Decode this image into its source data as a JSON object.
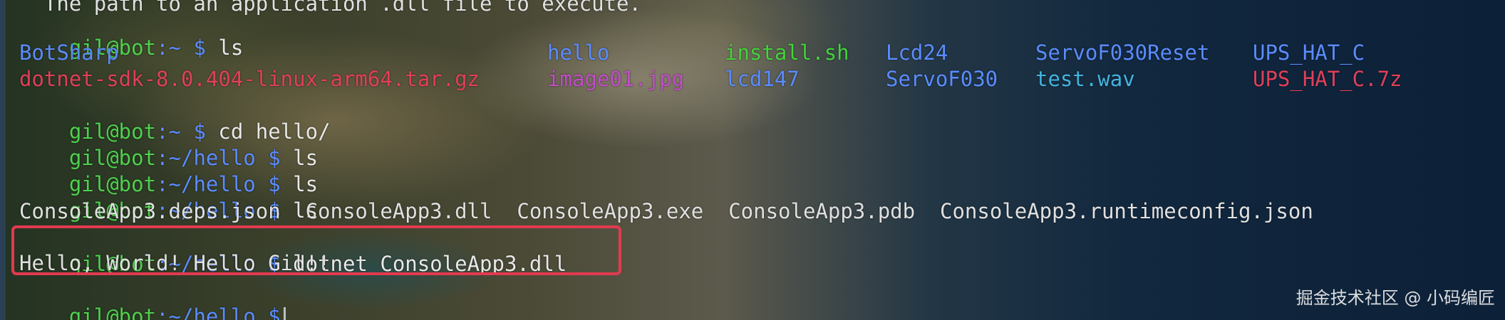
{
  "lines": [
    {
      "text": "  The path to an application .dll file to execute."
    },
    {
      "user": "gil@bot",
      "sep": ":",
      "path": "~",
      "prompt": "$",
      "cmd": "ls"
    },
    {
      "items": [
        {
          "name": "BotSharp",
          "kind": "dir"
        },
        {
          "name": "hello",
          "kind": "dir"
        },
        {
          "name": "install.sh",
          "kind": "exec"
        },
        {
          "name": "Lcd24",
          "kind": "dir"
        },
        {
          "name": "ServoF030Reset",
          "kind": "dir"
        },
        {
          "name": "UPS_HAT_C",
          "kind": "dir"
        }
      ]
    },
    {
      "items": [
        {
          "name": "dotnet-sdk-8.0.404-linux-arm64.tar.gz",
          "kind": "archive"
        },
        {
          "name": "image01.jpg",
          "kind": "image"
        },
        {
          "name": "lcd147",
          "kind": "dir"
        },
        {
          "name": "ServoF030",
          "kind": "dir"
        },
        {
          "name": "test.wav",
          "kind": "audio"
        },
        {
          "name": "UPS_HAT_C.7z",
          "kind": "archive"
        }
      ]
    },
    {
      "user": "gil@bot",
      "sep": ":",
      "path": "~",
      "prompt": "$",
      "cmd": "cd hello/"
    },
    {
      "user": "gil@bot",
      "sep": ":",
      "path": "~/hello",
      "prompt": "$",
      "cmd": "ls"
    },
    {
      "user": "gil@bot",
      "sep": ":",
      "path": "~/hello",
      "prompt": "$",
      "cmd": "ls"
    },
    {
      "user": "gil@bot",
      "sep": ":",
      "path": "~/hello",
      "prompt": "$",
      "cmd": "ls"
    },
    {
      "text": "ConsoleApp3.deps.json  ConsoleApp3.dll  ConsoleApp3.exe  ConsoleApp3.pdb  ConsoleApp3.runtimeconfig.json"
    },
    {
      "user": "gil@bot",
      "sep": ":",
      "path": "~/hello",
      "prompt": "$",
      "cmd": "dotnet ConsoleApp3.dll"
    },
    {
      "text": "Hello, World! Hello Gil!!"
    },
    {
      "user": "gil@bot",
      "sep": ":",
      "path": "~/hello",
      "prompt": "$",
      "cmd": ""
    }
  ],
  "watermark": "掘金技术社区 @ 小码编匠",
  "colors": {
    "user": "#4ed14e",
    "path": "#5b8cff",
    "executable": "#43d43b",
    "archive": "#e0405a",
    "image": "#c24dc8",
    "audio": "#43b4e0",
    "highlight_border": "#e23a4f"
  }
}
